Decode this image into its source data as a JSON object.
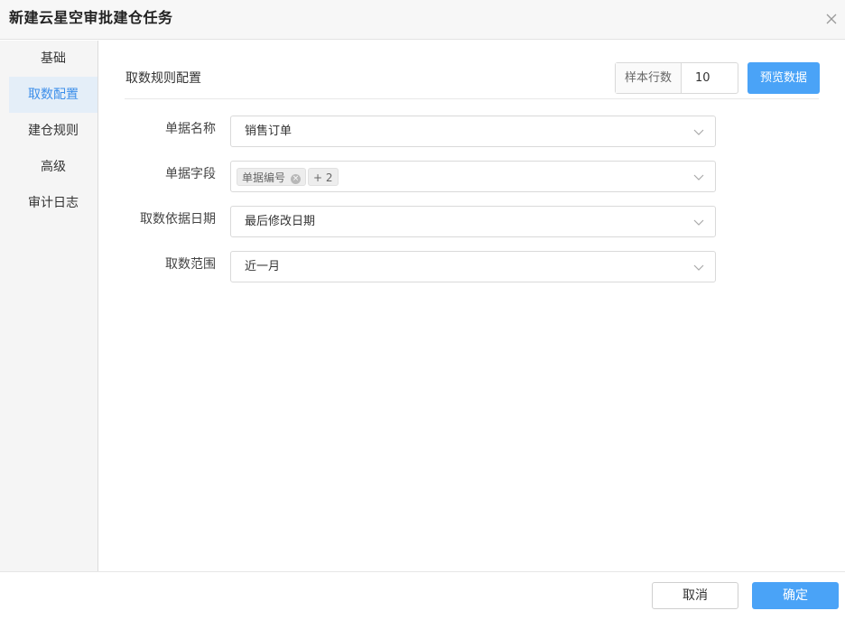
{
  "dialog": {
    "title": "新建云星空审批建仓任务"
  },
  "sidebar": {
    "items": [
      {
        "label": "基础",
        "active": false
      },
      {
        "label": "取数配置",
        "active": true
      },
      {
        "label": "建仓规则",
        "active": false
      },
      {
        "label": "高级",
        "active": false
      },
      {
        "label": "审计日志",
        "active": false
      }
    ]
  },
  "main": {
    "section_title": "取数规则配置",
    "sample": {
      "label": "样本行数",
      "value": "10"
    },
    "preview_button": "预览数据",
    "fields": {
      "doc_name": {
        "label": "单据名称",
        "value": "销售订单"
      },
      "doc_fields": {
        "label": "单据字段",
        "tag": "单据编号",
        "more": "+ 2"
      },
      "date_basis": {
        "label": "取数依据日期",
        "value": "最后修改日期"
      },
      "range": {
        "label": "取数范围",
        "value": "近一月"
      }
    }
  },
  "footer": {
    "cancel_label": "取消",
    "ok_label": "确定"
  },
  "colors": {
    "accent": "#4aa3f7",
    "active_nav_bg": "#e4eef8",
    "active_nav_text": "#3d8fea"
  }
}
